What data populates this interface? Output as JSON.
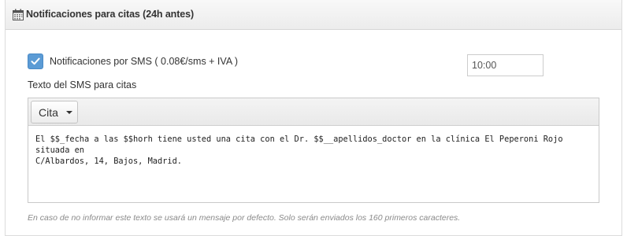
{
  "panel": {
    "title": "Notificaciones para citas (24h antes)",
    "icon": "calendar-icon"
  },
  "sms": {
    "checkbox_checked": true,
    "label": "Notificaciones por SMS ( 0.08€/sms + IVA )",
    "time_value": "10:00"
  },
  "message": {
    "label": "Texto del SMS para citas",
    "toolbar_button": "Cita",
    "body_line1": "El $$_fecha a las $$horh tiene usted una cita con el Dr. $$__apellidos_doctor en la clínica El Peperoni Rojo situada en",
    "body_line2": "C/Albardos, 14, Bajos, Madrid.",
    "help": "En caso de no informar este texto se usará un mensaje por defecto. Solo serán enviados los 160 primeros caracteres."
  },
  "colors": {
    "accent": "#5b9bd5",
    "help_text": "#8a8a8a"
  }
}
